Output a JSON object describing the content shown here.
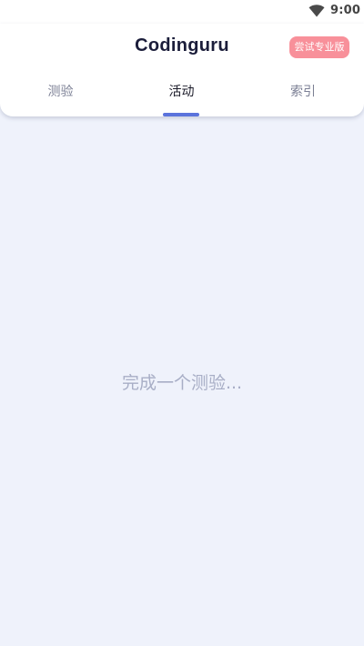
{
  "status_bar": {
    "time": "9:00",
    "wifi_icon": "wifi-icon"
  },
  "header": {
    "title": "Codinguru",
    "pro_button_label": "尝试专业版",
    "pro_button_color": "#f8909a"
  },
  "tabs": [
    {
      "label": "测验",
      "active": false
    },
    {
      "label": "活动",
      "active": true
    },
    {
      "label": "索引",
      "active": false
    }
  ],
  "main": {
    "empty_message": "完成一个测验..."
  },
  "colors": {
    "accent": "#5b73dc",
    "background": "#eff2fb",
    "title_text": "#1b1d3a"
  }
}
